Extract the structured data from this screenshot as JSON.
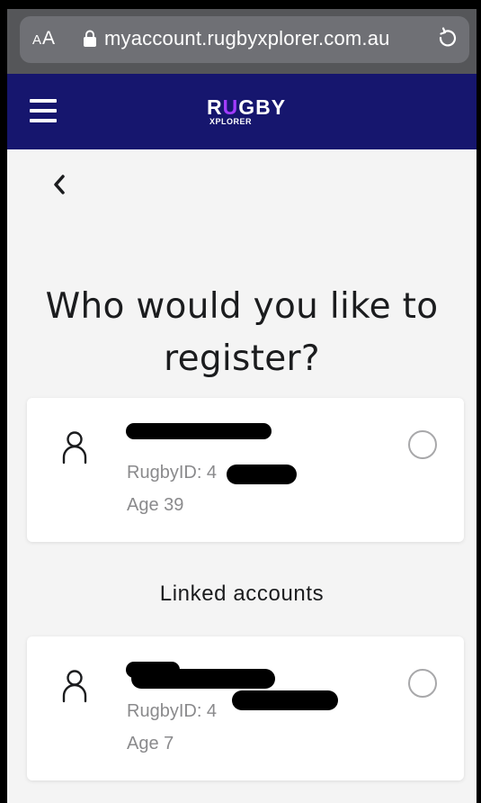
{
  "browser": {
    "aa_small": "A",
    "aa_large": "A",
    "url": "myaccount.rugbyxplorer.com.au"
  },
  "header": {
    "logo_main_prefix": "R",
    "logo_main_accent": "U",
    "logo_main_suffix": "GBY",
    "logo_sub": "XPLORER",
    "bg_color": "#16166e",
    "accent_color": "#a23cff"
  },
  "page": {
    "title": "Who would you like to register?"
  },
  "self_account": {
    "rugby_id_label": "RugbyID: 4",
    "age": "Age 39"
  },
  "linked": {
    "heading": "Linked accounts",
    "accounts": [
      {
        "rugby_id_label": "RugbyID: 4",
        "age": "Age 7"
      }
    ]
  }
}
